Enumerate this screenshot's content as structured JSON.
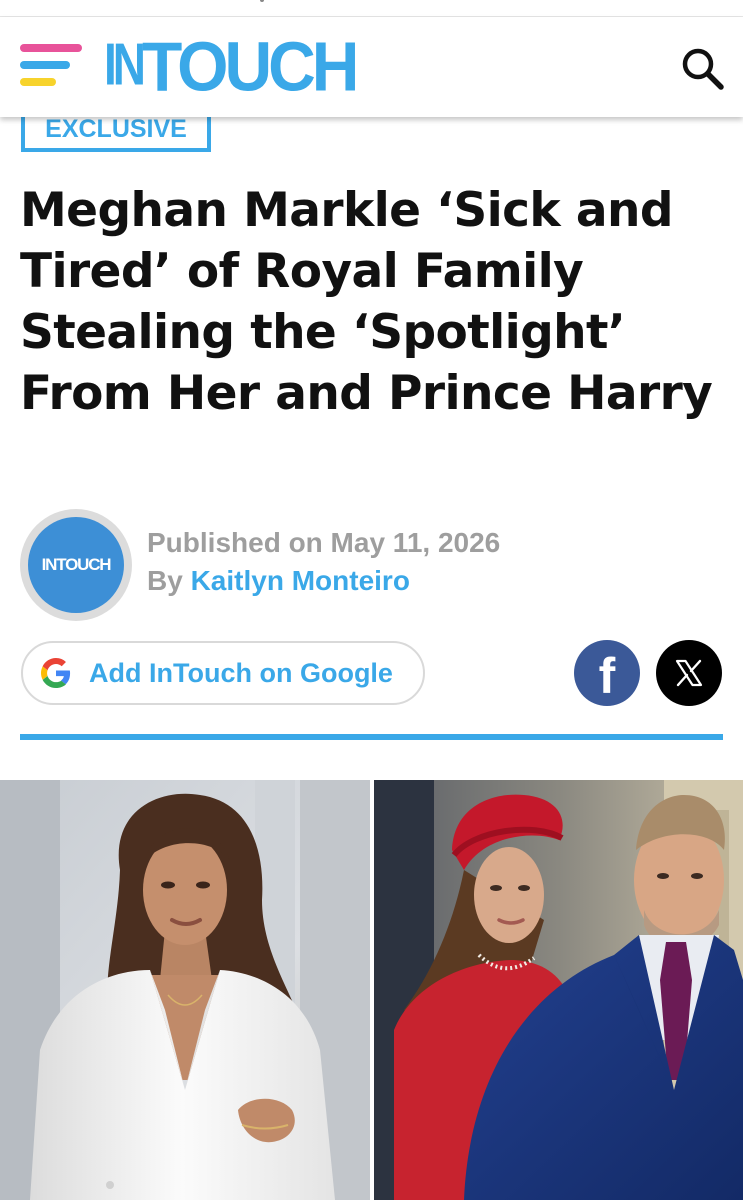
{
  "header": {
    "logo_small": "IN",
    "logo_big": "TOUCH",
    "menu_icon": "hamburger-menu-icon",
    "search_icon": "search-icon",
    "brand_colors": {
      "pink": "#e8539a",
      "blue": "#3aa8e8",
      "yellow": "#f7d32c"
    }
  },
  "article": {
    "tag": "EXCLUSIVE",
    "headline": "Meghan Markle ‘Sick and Tired’ of Royal Family Stealing the ‘Spotlight’ From Her and Prince Harry",
    "avatar_text": "INTOUCH",
    "published": "Published on May 11, 2026",
    "by_prefix": "By",
    "author": "Kaitlyn Monteiro"
  },
  "share": {
    "google_label": "Add InTouch on Google",
    "facebook_glyph": "f",
    "icons": [
      "google-g-icon",
      "facebook-icon",
      "x-icon"
    ]
  },
  "images": [
    {
      "subject": "woman-in-white-blazer"
    },
    {
      "subject": "couple-in-red-and-navy"
    }
  ]
}
